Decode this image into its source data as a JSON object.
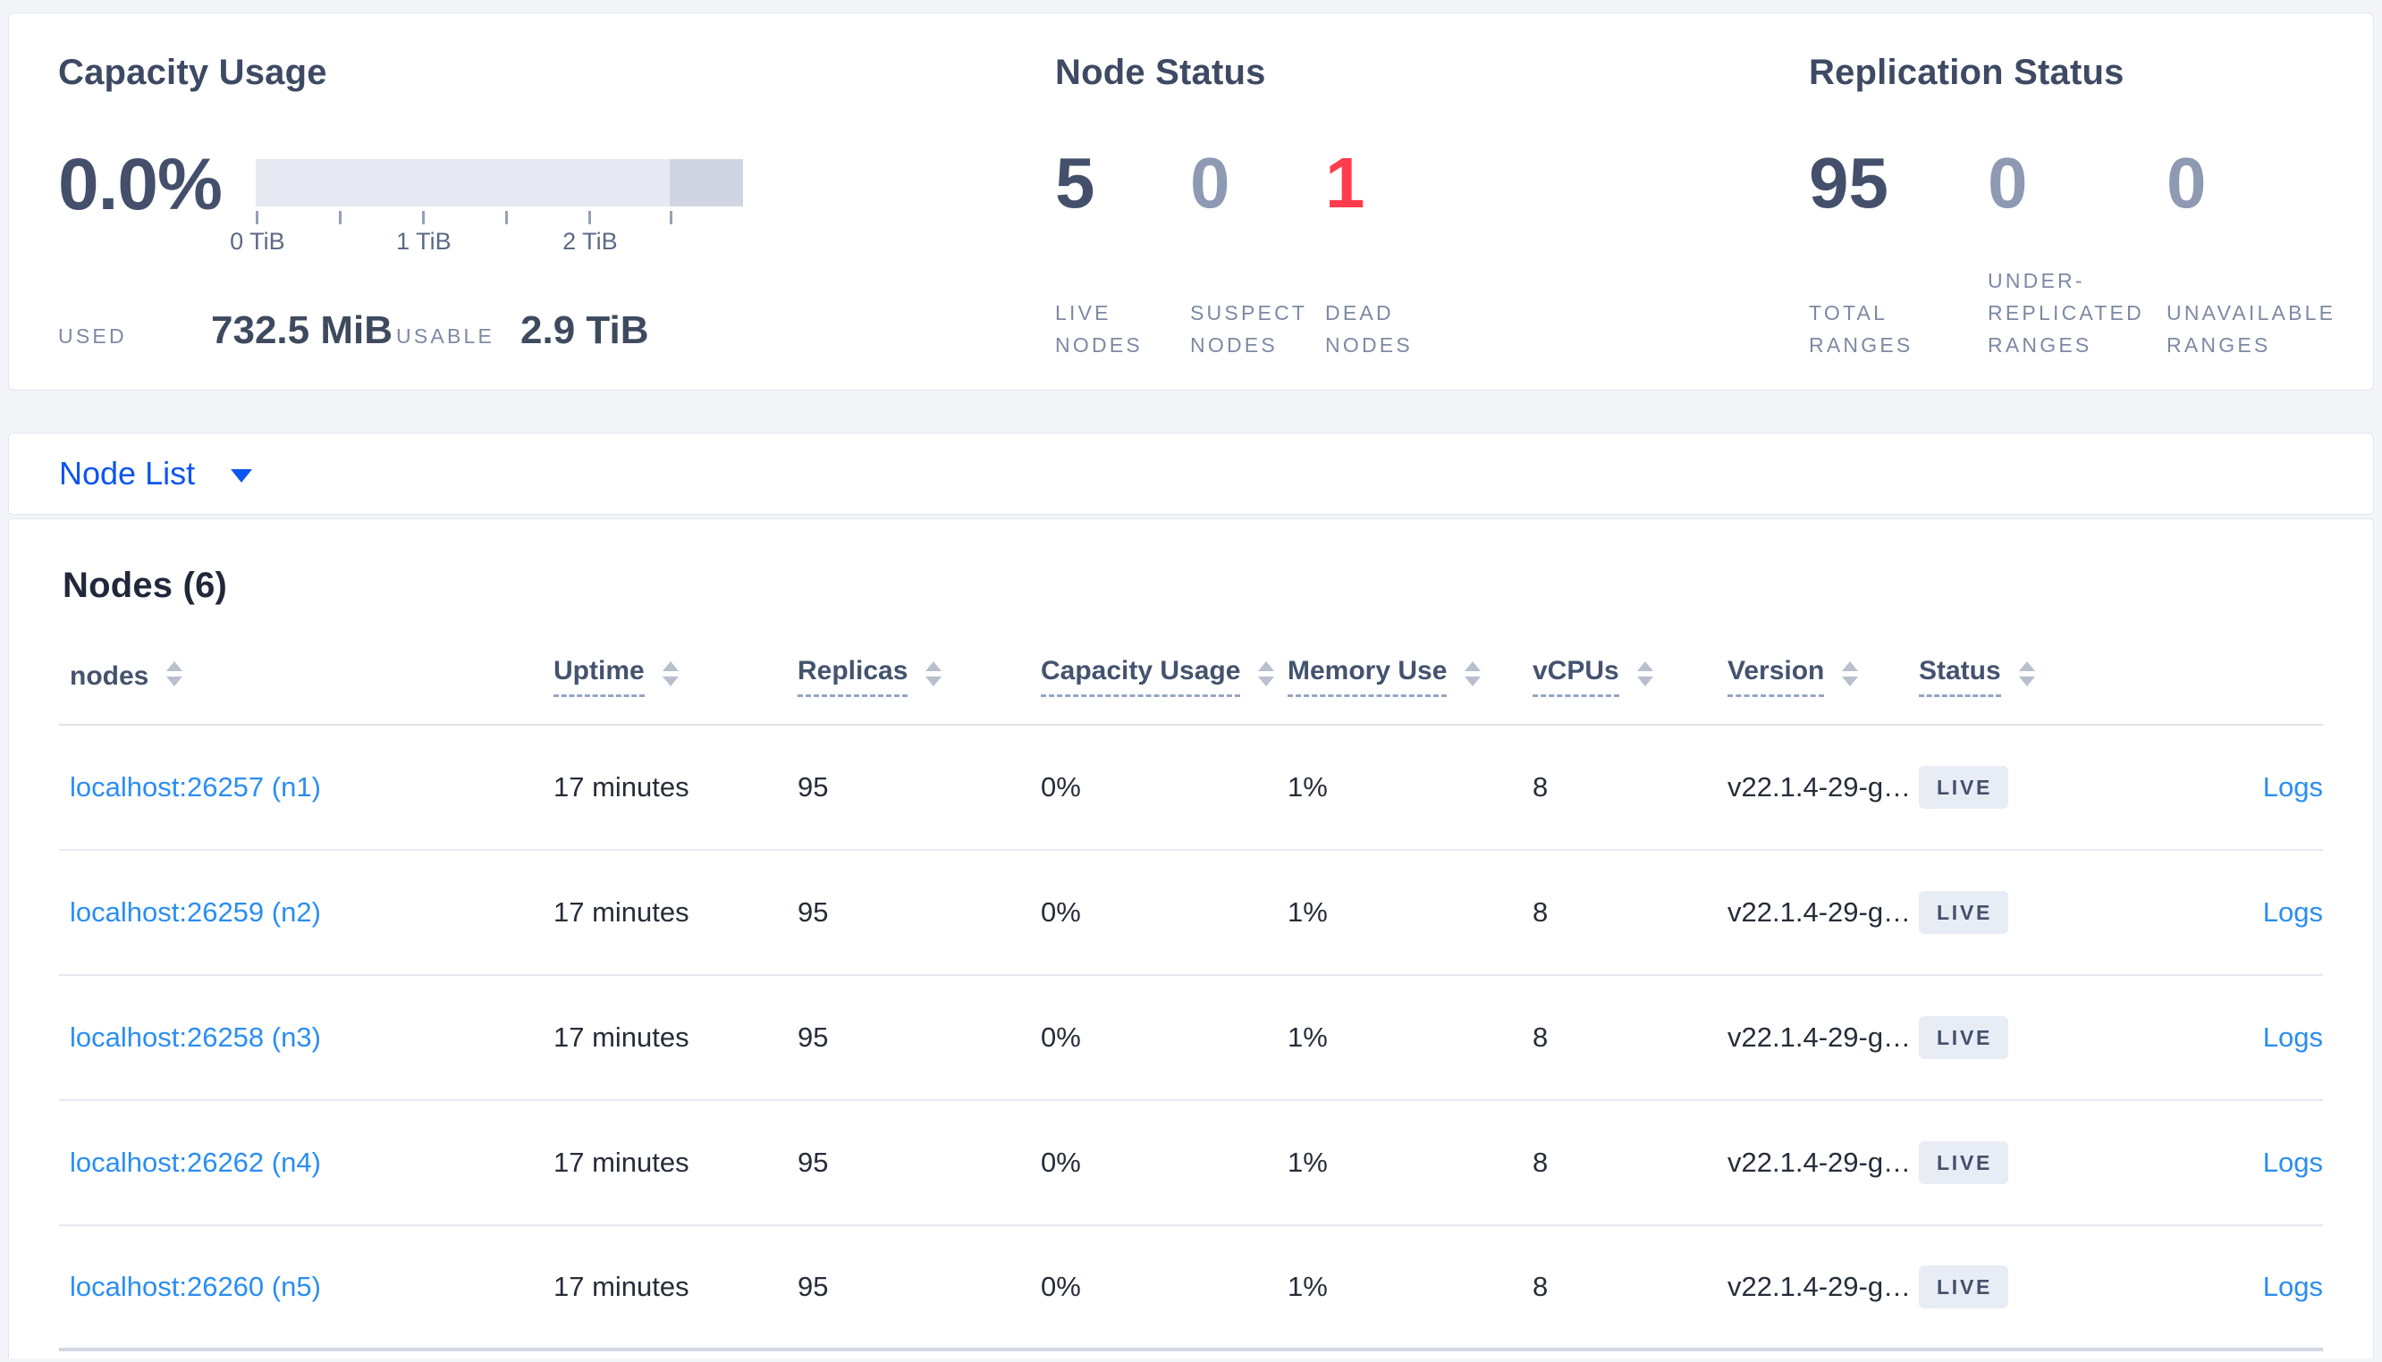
{
  "summary": {
    "capacity": {
      "title": "Capacity Usage",
      "percent": "0.0%",
      "tick_labels": [
        "0 TiB",
        "1 TiB",
        "2 TiB"
      ],
      "bar": {
        "total_width": 545,
        "other_width": 82
      },
      "used_label": "USED",
      "used_value": "732.5 MiB",
      "usable_label": "USABLE",
      "usable_value": "2.9 TiB"
    },
    "node_status": {
      "title": "Node Status",
      "stats": [
        {
          "value": "5",
          "label": "LIVE NODES",
          "tone": "dark"
        },
        {
          "value": "0",
          "label": "SUSPECT NODES",
          "tone": "muted"
        },
        {
          "value": "1",
          "label": "DEAD NODES",
          "tone": "red"
        }
      ]
    },
    "replication": {
      "title": "Replication Status",
      "stats": [
        {
          "value": "95",
          "label": "TOTAL RANGES",
          "tone": "dark"
        },
        {
          "value": "0",
          "label": "UNDER-REPLICATED RANGES",
          "tone": "muted"
        },
        {
          "value": "0",
          "label": "UNAVAILABLE RANGES",
          "tone": "muted"
        }
      ]
    }
  },
  "view_selector": {
    "label": "Node List"
  },
  "nodes_section": {
    "title": "Nodes (6)",
    "columns": [
      {
        "label": "nodes"
      },
      {
        "label": "Uptime"
      },
      {
        "label": "Replicas"
      },
      {
        "label": "Capacity Usage"
      },
      {
        "label": "Memory Use"
      },
      {
        "label": "vCPUs"
      },
      {
        "label": "Version"
      },
      {
        "label": "Status"
      },
      {
        "label": ""
      }
    ],
    "rows": [
      {
        "node": "localhost:26257 (n1)",
        "uptime": "17 minutes",
        "replicas": "95",
        "capacity": "0%",
        "memory": "1%",
        "vcpus": "8",
        "version": "v22.1.4-29-g…",
        "status": "LIVE",
        "logs": "Logs"
      },
      {
        "node": "localhost:26259 (n2)",
        "uptime": "17 minutes",
        "replicas": "95",
        "capacity": "0%",
        "memory": "1%",
        "vcpus": "8",
        "version": "v22.1.4-29-g…",
        "status": "LIVE",
        "logs": "Logs"
      },
      {
        "node": "localhost:26258 (n3)",
        "uptime": "17 minutes",
        "replicas": "95",
        "capacity": "0%",
        "memory": "1%",
        "vcpus": "8",
        "version": "v22.1.4-29-g…",
        "status": "LIVE",
        "logs": "Logs"
      },
      {
        "node": "localhost:26262 (n4)",
        "uptime": "17 minutes",
        "replicas": "95",
        "capacity": "0%",
        "memory": "1%",
        "vcpus": "8",
        "version": "v22.1.4-29-g…",
        "status": "LIVE",
        "logs": "Logs"
      },
      {
        "node": "localhost:26260 (n5)",
        "uptime": "17 minutes",
        "replicas": "95",
        "capacity": "0%",
        "memory": "1%",
        "vcpus": "8",
        "version": "v22.1.4-29-g…",
        "status": "LIVE",
        "logs": "Logs"
      }
    ]
  },
  "colors": {
    "accent_blue": "#0d55f0",
    "link_blue": "#2a8ef2",
    "danger_red": "#ff3b4e",
    "stat_dark": "#44506b",
    "stat_muted": "#8e99b3"
  }
}
